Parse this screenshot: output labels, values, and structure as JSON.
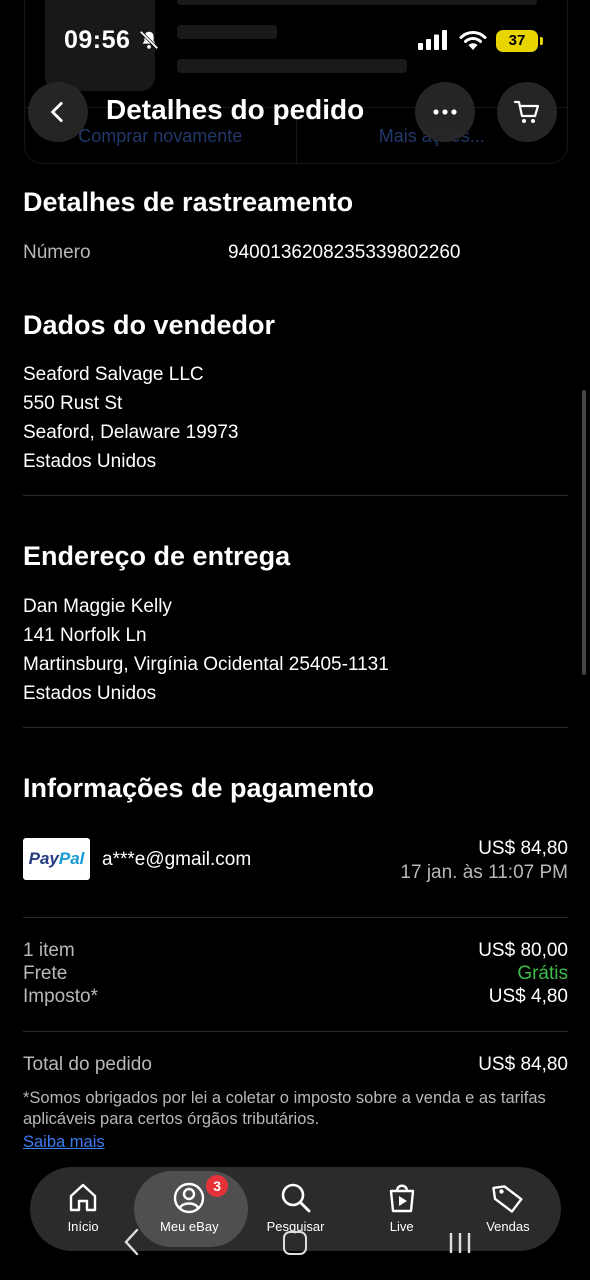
{
  "status_bar": {
    "time": "09:56",
    "battery": "37"
  },
  "background_card": {
    "buy_again": "Comprar novamente",
    "more_actions": "Mais ações..."
  },
  "header": {
    "title": "Detalhes do pedido"
  },
  "tracking": {
    "title": "Detalhes de rastreamento",
    "number_label": "Número",
    "number_value": "9400136208235339802260"
  },
  "seller": {
    "title": "Dados do vendedor",
    "lines": [
      "Seaford Salvage LLC",
      "550 Rust St",
      "Seaford, Delaware 19973",
      "Estados Unidos"
    ]
  },
  "shipping": {
    "title": "Endereço de entrega",
    "lines": [
      "Dan Maggie  Kelly",
      "141 Norfolk Ln",
      "Martinsburg, Virgínia Ocidental 25405-1131",
      "Estados Unidos"
    ]
  },
  "payment": {
    "title": "Informações de pagamento",
    "method_logo_dark": "Pay",
    "method_logo_light": "Pal",
    "email": "a***e@gmail.com",
    "amount": "US$ 84,80",
    "date": "17 jan. às 11:07 PM",
    "rows": [
      {
        "label": "1 item",
        "value": "US$ 80,00"
      },
      {
        "label": "Frete",
        "value": "Grátis"
      },
      {
        "label": "Imposto*",
        "value": "US$ 4,80"
      }
    ],
    "total_label": "Total do pedido",
    "total_value": "US$ 84,80",
    "note": "*Somos obrigados por lei a coletar o imposto sobre a venda e as tarifas aplicáveis para certos órgãos tributários.",
    "learn_more": "Saiba mais"
  },
  "bottom_nav": {
    "items": [
      {
        "label": "Início",
        "icon": "home-icon"
      },
      {
        "label": "Meu eBay",
        "icon": "user-icon",
        "badge": "3"
      },
      {
        "label": "Pesquisar",
        "icon": "search-icon"
      },
      {
        "label": "Live",
        "icon": "live-icon"
      },
      {
        "label": "Vendas",
        "icon": "tag-icon"
      }
    ]
  },
  "colors": {
    "free_green": "#3fbd4a",
    "link_blue": "#3d7bf0",
    "badge_red": "#e53238",
    "battery_yellow": "#e8d400"
  }
}
